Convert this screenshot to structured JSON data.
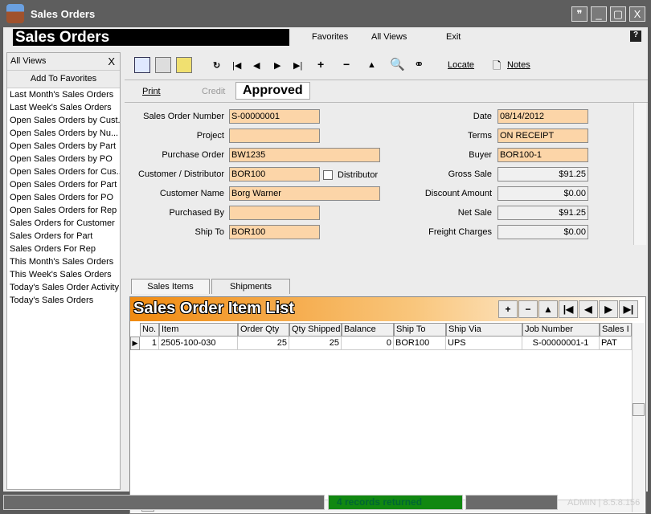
{
  "window": {
    "title": "Sales Orders",
    "buttons": [
      "chat",
      "minimize",
      "maximize",
      "close"
    ]
  },
  "menu": {
    "title": "Sales Orders",
    "items": [
      "Favorites",
      "All Views",
      "Exit"
    ],
    "help": "?"
  },
  "sidebar": {
    "header": "All Views",
    "close": "X",
    "add_favorites": "Add To Favorites",
    "items": [
      "Last Month's Sales Orders",
      "Last Week's Sales Orders",
      "Open Sales Orders by Cust...",
      "Open Sales Orders by Nu...",
      "Open Sales Orders by Part",
      "Open Sales Orders by PO",
      "Open Sales Orders for Cus...",
      "Open Sales Orders for Part",
      "Open Sales Orders for PO",
      "Open Sales Orders for Rep",
      "Sales Orders for Customer",
      "Sales Orders for Part",
      "Sales Orders For Rep",
      "This Month's Sales Orders",
      "This Week's Sales Orders",
      "Today's Sales Order Activity",
      "Today's Sales Orders"
    ]
  },
  "toolbar": {
    "locate": "Locate",
    "notes": "Notes",
    "print": "Print",
    "credit": "Credit",
    "status": "Approved"
  },
  "form": {
    "left": [
      {
        "label": "Sales Order Number",
        "value": "S-00000001"
      },
      {
        "label": "Project",
        "value": ""
      },
      {
        "label": "Purchase Order",
        "value": "BW1235"
      },
      {
        "label": "Customer / Distributor",
        "value": "BOR100"
      },
      {
        "label": "Customer Name",
        "value": "Borg Warner"
      },
      {
        "label": "Purchased By",
        "value": ""
      },
      {
        "label": "Ship To",
        "value": "BOR100"
      }
    ],
    "distributor_label": "Distributor",
    "right": [
      {
        "label": "Date",
        "value": "08/14/2012"
      },
      {
        "label": "Terms",
        "value": "ON RECEIPT"
      },
      {
        "label": "Buyer",
        "value": "BOR100-1"
      },
      {
        "label": "Gross Sale",
        "value": "$91.25"
      },
      {
        "label": "Discount Amount",
        "value": "$0.00"
      },
      {
        "label": "Net Sale",
        "value": "$91.25"
      },
      {
        "label": "Freight Charges",
        "value": "$0.00"
      }
    ]
  },
  "tabs": [
    "Sales Items",
    "Shipments"
  ],
  "grid": {
    "title": "Sales Order Item List",
    "nav": [
      "+",
      "−",
      "▲",
      "|◀",
      "◀",
      "▶",
      "▶|"
    ],
    "columns": [
      "No.",
      "Item",
      "Order Qty",
      "Qty Shipped",
      "Balance",
      "Ship To",
      "Ship Via",
      "Job Number",
      "Sales I"
    ],
    "rows": [
      [
        "1",
        "2505-100-030",
        "25",
        "25",
        "0",
        "BOR100",
        "UPS",
        "S-00000001-1",
        "PAT"
      ]
    ]
  },
  "statusbar": {
    "message": "4 records returned",
    "user": "ADMIN | 8.5.8.156"
  },
  "colors": {
    "field": "#fcd5a8",
    "status_ok": "#118811",
    "accent": "#f08a10"
  }
}
